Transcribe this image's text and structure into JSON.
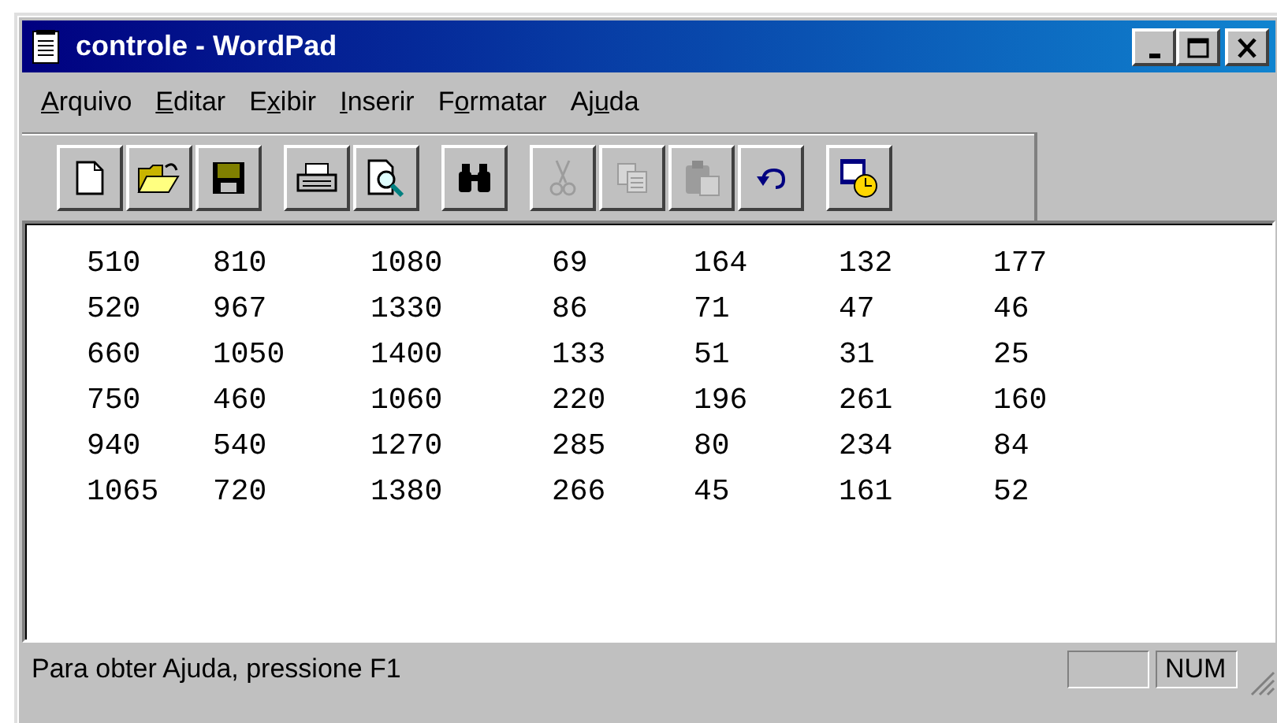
{
  "window": {
    "title": "controle - WordPad"
  },
  "menu": [
    {
      "key": "A",
      "post": "rquivo"
    },
    {
      "key": "E",
      "post": "ditar"
    },
    {
      "pre": "E",
      "key": "x",
      "post": "ibir"
    },
    {
      "key": "I",
      "post": "nserir"
    },
    {
      "pre": "F",
      "key": "o",
      "post": "rmatar"
    },
    {
      "pre": "Aj",
      "key": "u",
      "post": "da"
    }
  ],
  "toolbar": [
    [
      {
        "kind": "new",
        "disabled": false
      },
      {
        "kind": "open",
        "disabled": false
      },
      {
        "kind": "save",
        "disabled": false
      }
    ],
    [
      {
        "kind": "print",
        "disabled": false
      },
      {
        "kind": "preview",
        "disabled": false
      }
    ],
    [
      {
        "kind": "find",
        "disabled": false
      }
    ],
    [
      {
        "kind": "cut",
        "disabled": true
      },
      {
        "kind": "copy",
        "disabled": true
      },
      {
        "kind": "paste",
        "disabled": true
      },
      {
        "kind": "undo",
        "disabled": false
      }
    ],
    [
      {
        "kind": "datetime",
        "disabled": false
      }
    ]
  ],
  "document": {
    "rows": [
      [
        "510",
        "810",
        "1080",
        "69",
        "164",
        "132",
        "177"
      ],
      [
        "520",
        "967",
        "1330",
        "86",
        "71",
        "47",
        "46"
      ],
      [
        "660",
        "1050",
        "1400",
        "133",
        "51",
        "31",
        "25"
      ],
      [
        "750",
        "460",
        "1060",
        "220",
        "196",
        "261",
        "160"
      ],
      [
        "940",
        "540",
        "1270",
        "285",
        "80",
        "234",
        "84"
      ],
      [
        "1065",
        "720",
        "1380",
        "266",
        "45",
        "161",
        "52"
      ]
    ]
  },
  "status_bar": {
    "text": "Para obter Ajuda, pressione F1",
    "indicators": [
      "NUM"
    ]
  }
}
